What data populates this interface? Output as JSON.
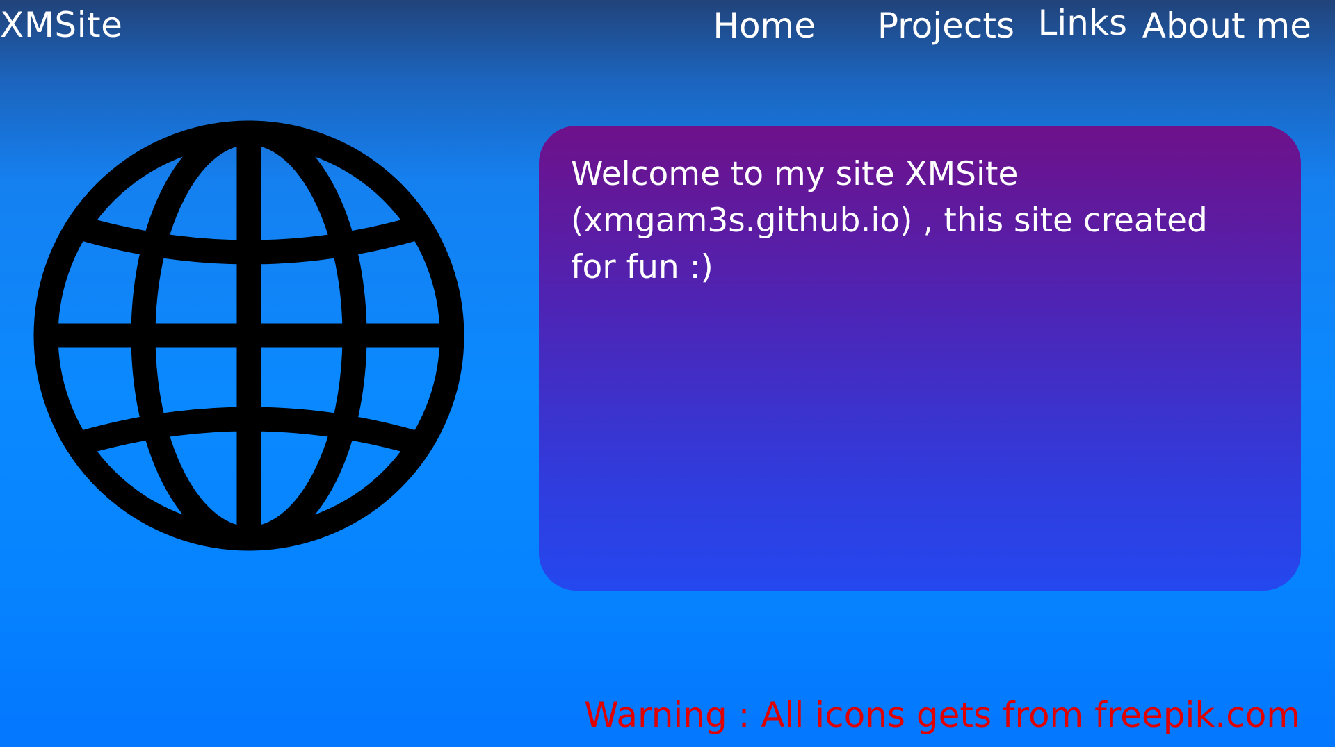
{
  "header": {
    "brand": "XMSite",
    "nav": {
      "home": "Home",
      "projects": "Projects",
      "links": "Links",
      "about": "About me"
    }
  },
  "main": {
    "icon": "globe-icon",
    "welcome_text": "Welcome to my site XMSite (xmgam3s.github.io) , this site created for fun :)"
  },
  "footer": {
    "warning": "Warning : All icons gets from freepik.com"
  },
  "colors": {
    "header_text": "#ffffff",
    "card_top": "#6e118a",
    "card_bottom": "#2448ef",
    "warning_text": "#e00000",
    "icon": "#000000"
  }
}
